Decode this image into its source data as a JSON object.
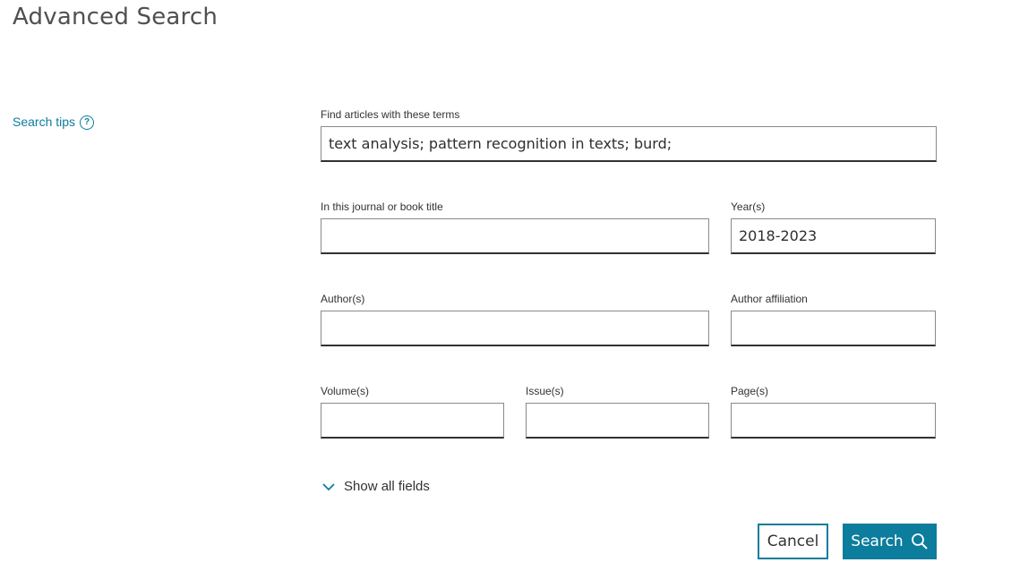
{
  "page": {
    "title": "Advanced Search"
  },
  "sidebar": {
    "search_tips_label": "Search tips",
    "help_icon_glyph": "?"
  },
  "form": {
    "terms": {
      "label": "Find articles with these terms",
      "value": "text analysis; pattern recognition in texts; burd;"
    },
    "journal": {
      "label": "In this journal or book title",
      "value": ""
    },
    "years": {
      "label": "Year(s)",
      "value": "2018-2023"
    },
    "authors": {
      "label": "Author(s)",
      "value": ""
    },
    "affiliation": {
      "label": "Author affiliation",
      "value": ""
    },
    "volumes": {
      "label": "Volume(s)",
      "value": ""
    },
    "issues": {
      "label": "Issue(s)",
      "value": ""
    },
    "pages": {
      "label": "Page(s)",
      "value": ""
    },
    "show_all_label": "Show all fields"
  },
  "actions": {
    "cancel_label": "Cancel",
    "search_label": "Search"
  },
  "icons": {
    "help": "help-circle-icon",
    "chevron": "chevron-down-icon",
    "search": "search-icon"
  },
  "colors": {
    "accent": "#0c7d9d",
    "text": "#323232",
    "title": "#505050"
  }
}
